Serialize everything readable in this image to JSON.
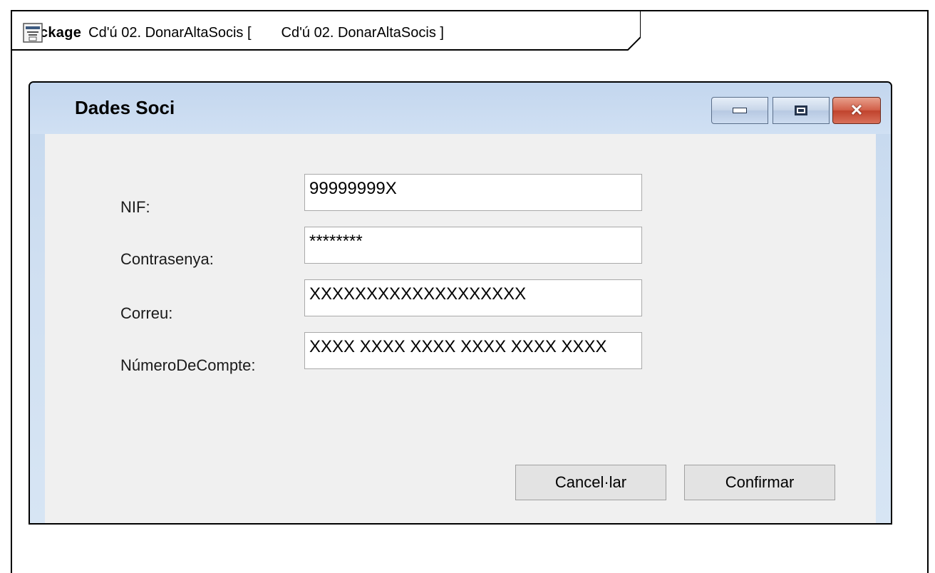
{
  "frame": {
    "keyword": "package",
    "name": "Cd'ú 02. DonarAltaSocis [",
    "diagram_name": "Cd'ú 02. DonarAltaSocis  ]",
    "icon": "diagram-icon"
  },
  "window": {
    "title": "Dades Soci",
    "controls": [
      "minimize-icon",
      "maximize-icon",
      "close-icon"
    ]
  },
  "form": {
    "fields": [
      {
        "label": "NIF:",
        "value": "99999999X"
      },
      {
        "label": "Contrasenya:",
        "value": "********"
      },
      {
        "label": "Correu:",
        "value": "XXXXXXXXXXXXXXXXXXX"
      },
      {
        "label": "NúmeroDeCompte:",
        "value": "XXXX XXXX XXXX XXXX XXXX XXXX"
      }
    ]
  },
  "buttons": {
    "cancel": "Cancel·lar",
    "confirm": "Confirmar"
  },
  "colors": {
    "titlebar": "#c5d8ee",
    "content_bg": "#f0f0f0",
    "close_button": "#c0432d"
  }
}
